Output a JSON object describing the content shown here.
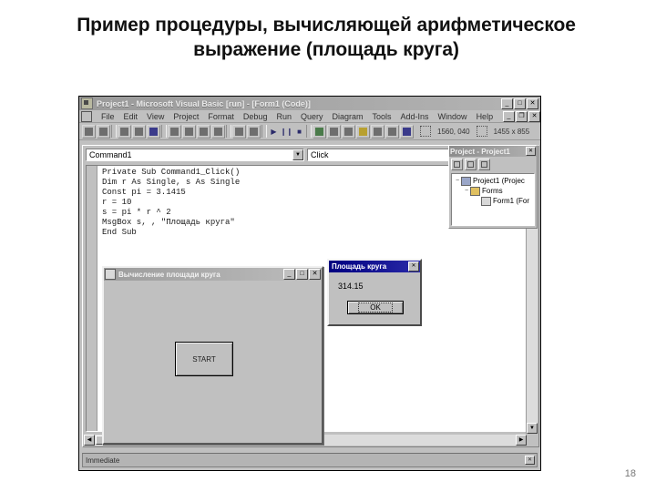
{
  "slide": {
    "title": "Пример процедуры, вычисляющей арифметическое выражение (площадь круга)",
    "page_number": "18"
  },
  "vb_window": {
    "title": "Project1 - Microsoft Visual Basic [run] - [Form1 (Code)]",
    "app_icon": "vb-app-icon",
    "window_buttons": {
      "minimize": "_",
      "maximize": "□",
      "close": "✕",
      "child_minimize": "_",
      "child_restore": "❐",
      "child_close": "✕"
    },
    "menu": [
      {
        "label": "File"
      },
      {
        "label": "Edit"
      },
      {
        "label": "View"
      },
      {
        "label": "Project"
      },
      {
        "label": "Format"
      },
      {
        "label": "Debug"
      },
      {
        "label": "Run"
      },
      {
        "label": "Query"
      },
      {
        "label": "Diagram"
      },
      {
        "label": "Tools"
      },
      {
        "label": "Add-Ins"
      },
      {
        "label": "Window"
      },
      {
        "label": "Help"
      }
    ],
    "toolbar": {
      "run_icon": "▶",
      "pause_icon": "❙❙",
      "stop_icon": "■",
      "position": "1560, 040",
      "size": "1455 x 855",
      "position_icon": "position-icon",
      "size_icon": "size-icon"
    },
    "code_window": {
      "object_combo": "Command1",
      "procedure_combo": "Click",
      "combo_arrow": "▼",
      "code": "Private Sub Command1_Click()\nDim r As Single, s As Single\nConst pi = 3.1415\nr = 10\ns = pi * r ^ 2\nMsgBox s, , \"Площадь круга\"\nEnd Sub",
      "scroll_up": "▲",
      "scroll_down": "▼",
      "scroll_left": "◀",
      "scroll_right": "▶"
    },
    "project_explorer": {
      "title": "Project - Project1",
      "close": "✕",
      "toolbar_buttons": [
        "view-code-button",
        "view-object-button",
        "toggle-folders-button"
      ],
      "tree": [
        {
          "expander": "−",
          "icon": "project-icon",
          "label": "Project1 (Projec"
        },
        {
          "expander": "−",
          "icon": "folder-icon",
          "label": "Forms"
        },
        {
          "expander": "",
          "icon": "form-icon",
          "label": "Form1 (For"
        }
      ]
    },
    "immediate_panel": {
      "label": "Immediate",
      "close": "✕"
    }
  },
  "form_window": {
    "title": "Вычисление площади круга",
    "icon": "form-icon",
    "buttons": {
      "minimize": "_",
      "maximize": "□",
      "close": "✕"
    },
    "start_button": "START"
  },
  "msgbox": {
    "title": "Площадь круга",
    "close": "✕",
    "value": "314.15",
    "ok_button": "OK"
  }
}
